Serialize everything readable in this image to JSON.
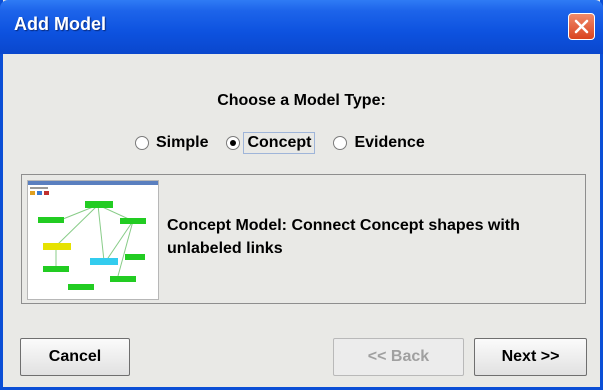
{
  "window": {
    "title": "Add Model"
  },
  "prompt": "Choose a Model Type:",
  "model_types": [
    {
      "label": "Simple",
      "selected": false
    },
    {
      "label": "Concept",
      "selected": true
    },
    {
      "label": "Evidence",
      "selected": false
    }
  ],
  "description": "Concept Model: Connect Concept shapes with unlabeled links",
  "buttons": {
    "cancel": "Cancel",
    "back": "<< Back",
    "next": "Next >>"
  },
  "icons": {
    "close": "close-icon"
  },
  "colors": {
    "titlebar": "#0d52df",
    "close": "#d9431f",
    "node_green": "#22cc22",
    "node_yellow": "#e6e200",
    "node_cyan": "#33ccee"
  }
}
